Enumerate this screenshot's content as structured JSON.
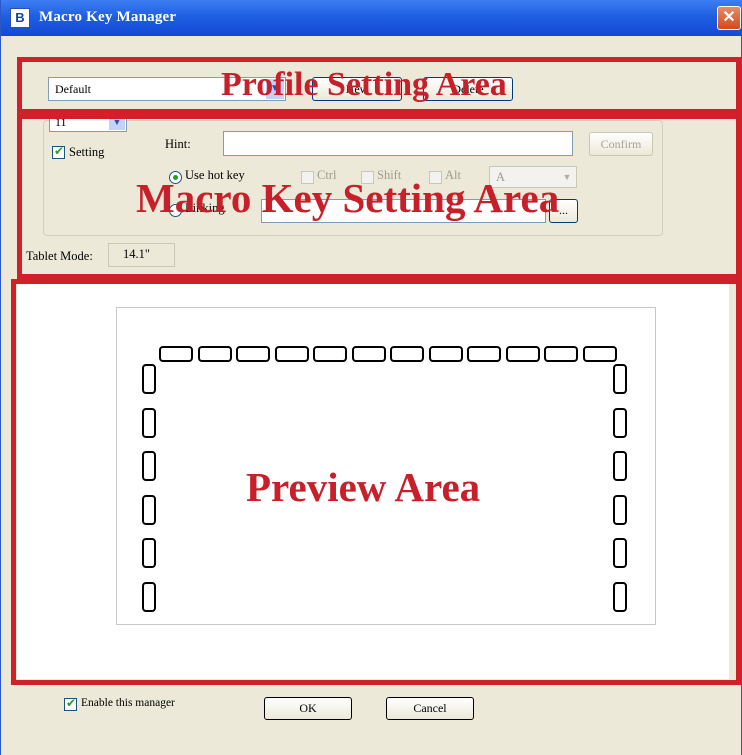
{
  "window": {
    "title": "Macro Key Manager",
    "app_icon_glyph": "B",
    "close_glyph": "✕"
  },
  "profile": {
    "selected": "Default",
    "new_label": "New",
    "delete_label": "Delete",
    "area_label": "Profile Setting Area"
  },
  "macro": {
    "key_selected": "11",
    "setting_label": "Setting",
    "hint_label": "Hint:",
    "hint_value": "",
    "confirm_label": "Confirm",
    "use_hot_key_label": "Use hot key",
    "ctrl_label": "Ctrl",
    "shift_label": "Shift",
    "alt_label": "Alt",
    "key_value": "A",
    "linking_label": "Linking",
    "linking_value": "",
    "browse_label": "...",
    "area_label": "Macro Key Setting Area"
  },
  "tablet_mode": {
    "label": "Tablet Mode:",
    "value": "14.1\""
  },
  "preview": {
    "area_label": "Preview Area",
    "top_key_count": 12,
    "side_key_count": 6
  },
  "footer": {
    "enable_label": "Enable this manager",
    "ok_label": "OK",
    "cancel_label": "Cancel"
  },
  "colors": {
    "annotation_red": "#d0212b",
    "titlebar_blue": "#1f5fe2",
    "dialog_bg": "#ece9d8"
  }
}
